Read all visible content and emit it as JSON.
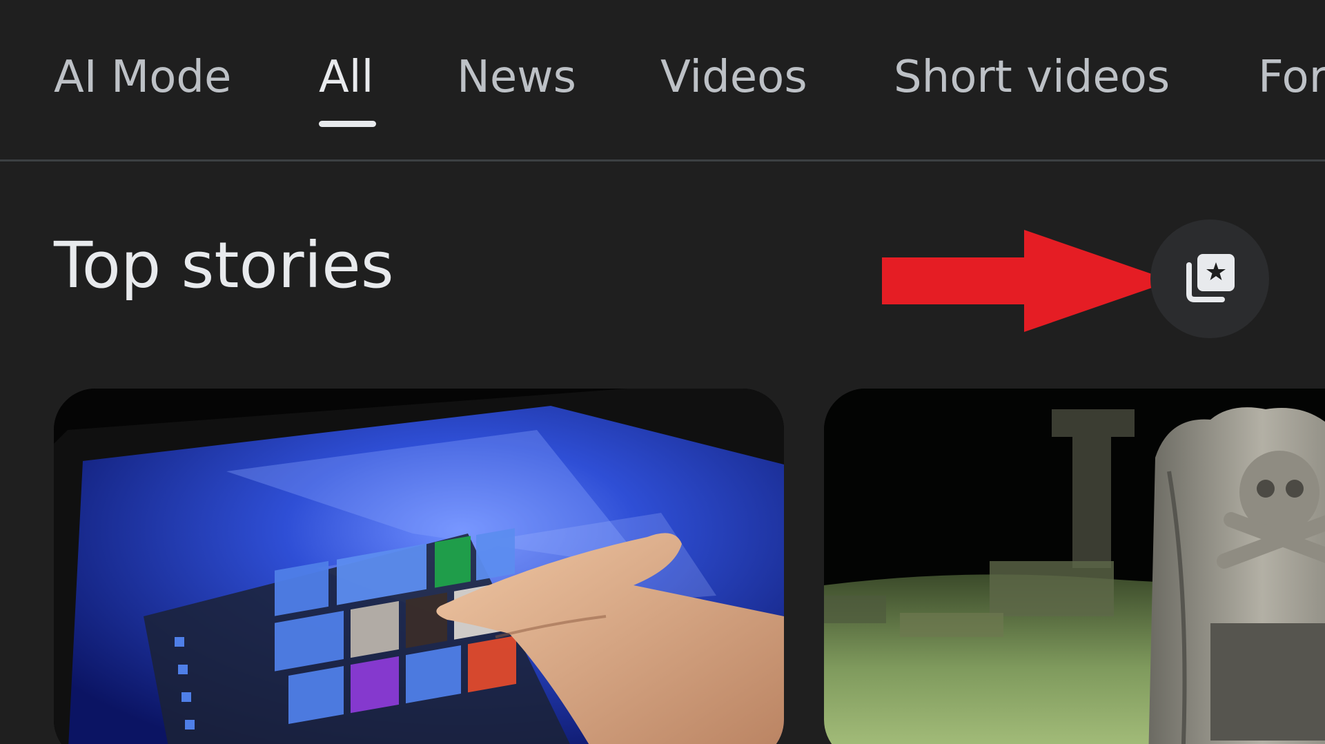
{
  "tabs": [
    {
      "label": "AI Mode",
      "active": false
    },
    {
      "label": "All",
      "active": true
    },
    {
      "label": "News",
      "active": false
    },
    {
      "label": "Videos",
      "active": false
    },
    {
      "label": "Short videos",
      "active": false
    },
    {
      "label": "For",
      "active": false
    }
  ],
  "section": {
    "title": "Top stories",
    "action_icon": "stories-collection-star-icon"
  },
  "colors": {
    "background": "#1f1f1f",
    "tab_text": "#bdc1c6",
    "tab_active": "#e8eaed",
    "annotation_arrow": "#e51d24",
    "icon_button_bg": "#2b2c2e"
  },
  "stories": [
    {
      "image": "windows-tablet-touch-photo"
    },
    {
      "image": "graveyard-skull-tombstone-photo"
    }
  ]
}
